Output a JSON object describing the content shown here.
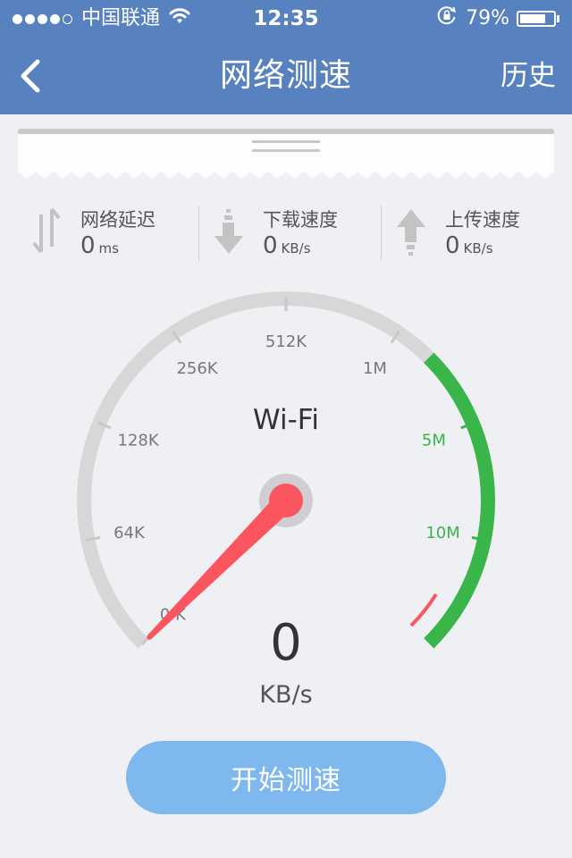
{
  "status_bar": {
    "carrier": "中国联通",
    "time": "12:35",
    "battery": "79%",
    "battery_level": 0.79
  },
  "nav": {
    "title": "网络测速",
    "history": "历史",
    "back_icon": "chevron-left-icon"
  },
  "stats": {
    "latency": {
      "label": "网络延迟",
      "value": "0",
      "unit": "ms",
      "icon": "up-down-arrows-icon"
    },
    "download": {
      "label": "下载速度",
      "value": "0",
      "unit": "KB/s",
      "icon": "download-arrow-icon"
    },
    "upload": {
      "label": "上传速度",
      "value": "0",
      "unit": "KB/s",
      "icon": "upload-arrow-icon"
    }
  },
  "gauge": {
    "network": "Wi-Fi",
    "ticks": [
      "0 K",
      "64K",
      "128K",
      "256K",
      "512K",
      "1M",
      "5M",
      "10M"
    ],
    "value": "0",
    "unit": "KB/s",
    "track_color": "#d7d7d7",
    "high_color": "#39b54a",
    "needle_color": "#fb5560"
  },
  "start_button": {
    "label": "开始测速"
  },
  "colors": {
    "header": "#5881c0",
    "background": "#eff0f4",
    "button": "#7fb8ee"
  }
}
